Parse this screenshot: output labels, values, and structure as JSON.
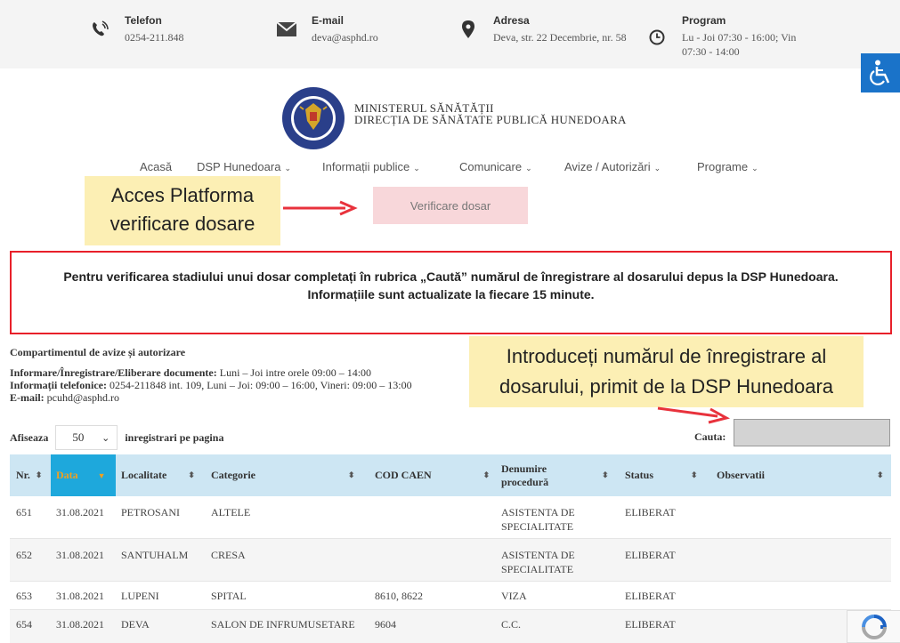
{
  "topbar": {
    "phone": {
      "title": "Telefon",
      "value": "0254-211.848"
    },
    "email": {
      "title": "E-mail",
      "value": "deva@asphd.ro"
    },
    "address": {
      "title": "Adresa",
      "value": "Deva, str. 22 Decembrie, nr. 58"
    },
    "schedule": {
      "title": "Program",
      "line1": "Lu - Joi 07:30 - 16:00; Vin",
      "line2": "07:30 - 14:00"
    }
  },
  "header": {
    "ministry_line1": "MINISTERUL SĂNĂTĂȚII",
    "ministry_line2": "DIRECȚIA DE SĂNĂTATE PUBLICĂ HUNEDOARA"
  },
  "nav": {
    "items": [
      {
        "label": "Acasă",
        "caret": ""
      },
      {
        "label": "DSP Hunedoara",
        "caret": "⌄"
      },
      {
        "label": "Informații publice",
        "caret": "⌄"
      },
      {
        "label": "Comunicare",
        "caret": "⌄"
      },
      {
        "label": "Avize / Autorizări",
        "caret": "⌄"
      },
      {
        "label": "Programe",
        "caret": "⌄"
      }
    ]
  },
  "callout1": {
    "line1": "Acces Platforma",
    "line2": "verificare dosare"
  },
  "verif_button": "Verificare dosar",
  "notice": {
    "line1": "Pentru verificarea stadiului unui dosar completați în rubrica „Caută” numărul de înregistrare al dosarului depus la DSP Hunedoara.",
    "line2": "Informațiile sunt actualizate la fiecare 15 minute."
  },
  "section": {
    "title": "Compartimentul de avize și autorizare",
    "info1_label": "Informare/Înregistrare/Eliberare documente:",
    "info1_value": " Luni – Joi intre orele 09:00 – 14:00",
    "info2_label": "Informații telefonice:",
    "info2_value": " 0254-211848 int. 109, Luni – Joi: 09:00 – 16:00, Vineri: 09:00 – 13:00",
    "info3_label": "E-mail:",
    "info3_value": " pcuhd@asphd.ro"
  },
  "callout2": {
    "line1": "Introduceți numărul de înregistrare al",
    "line2": "dosarului, primit de la DSP Hunedoara"
  },
  "controls": {
    "show_label": "Afiseaza",
    "page_size": "50",
    "per_page_label": "inregistrari pe pagina",
    "search_label": "Cauta:"
  },
  "table": {
    "headers": {
      "nr": "Nr.",
      "data": "Data",
      "localitate": "Localitate",
      "categorie": "Categorie",
      "cod_caen": "COD CAEN",
      "denumire_1": "Denumire",
      "denumire_2": "procedură",
      "status": "Status",
      "observatii": "Observatii"
    },
    "rows": [
      {
        "nr": "651",
        "data": "31.08.2021",
        "localitate": "PETROSANI",
        "categorie": "ALTELE",
        "cod_caen": "",
        "den1": "ASISTENTA DE",
        "den2": "SPECIALITATE",
        "status": "ELIBERAT",
        "obs": ""
      },
      {
        "nr": "652",
        "data": "31.08.2021",
        "localitate": "SANTUHALM",
        "categorie": "CRESA",
        "cod_caen": "",
        "den1": "ASISTENTA DE",
        "den2": "SPECIALITATE",
        "status": "ELIBERAT",
        "obs": ""
      },
      {
        "nr": "653",
        "data": "31.08.2021",
        "localitate": "LUPENI",
        "categorie": "SPITAL",
        "cod_caen": "8610, 8622",
        "den1": "VIZA",
        "den2": "",
        "status": "ELIBERAT",
        "obs": ""
      },
      {
        "nr": "654",
        "data": "31.08.2021",
        "localitate": "DEVA",
        "categorie": "SALON DE INFRUMUSETARE",
        "cod_caen": "9604",
        "den1": "C.C.",
        "den2": "",
        "status": "ELIBERAT",
        "obs": ""
      }
    ]
  },
  "colors": {
    "accent_blue": "#1ea8dc",
    "header_bg": "#cde6f3",
    "notice_border": "#e8202a",
    "callout_bg": "#fcefb4",
    "arrow": "#e8323c"
  }
}
